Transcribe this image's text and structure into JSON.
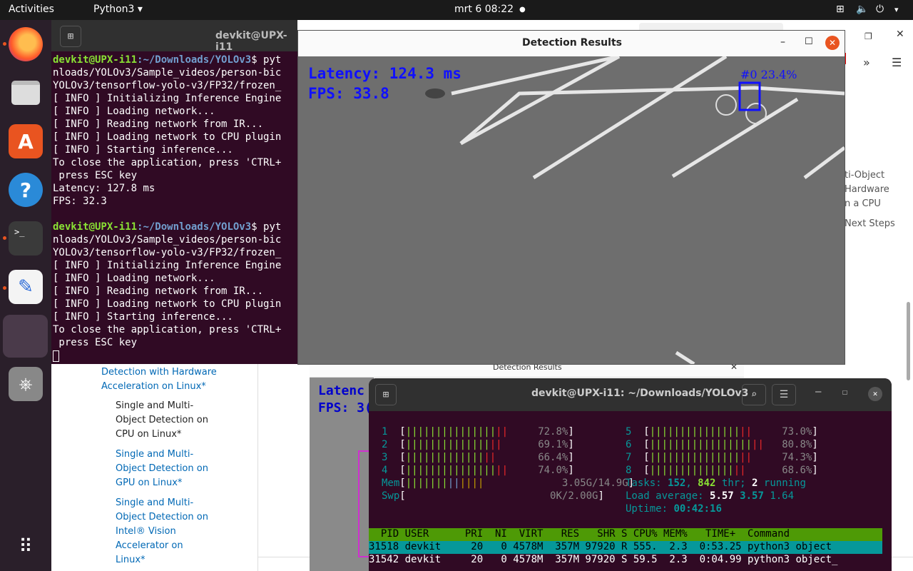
{
  "topbar": {
    "activities": "Activities",
    "app": "Python3",
    "datetime": "mrt 6  08:22"
  },
  "dock": {
    "items": [
      "firefox",
      "files",
      "software",
      "help",
      "terminal",
      "text-editor",
      "active-window",
      "usb"
    ]
  },
  "browser": {
    "toc": [
      "Detection with Hardware",
      "Acceleration on Linux*",
      "Single and Multi-",
      "Object Detection on",
      "CPU on Linux*",
      "Single and Multi-",
      "Object Detection on",
      "GPU on Linux*",
      "Single and Multi-",
      "Object Detection on",
      "Intel® Vision",
      "Accelerator on",
      "Linux*"
    ],
    "right_nav": [
      "ti-Object",
      "Hardware",
      "n a CPU",
      "Next Steps"
    ],
    "second_window_title": "Detection Results",
    "second_latency": "Latenc",
    "second_fps": "FPS: 3("
  },
  "terminal1": {
    "title": "devkit@UPX-i11",
    "lines": [
      {
        "user": "devkit@UPX-i11",
        "path": ":~/Downloads/YOLOv3",
        "rest": "$ pyt"
      },
      {
        "text": "nloads/YOLOv3/Sample_videos/person-bic"
      },
      {
        "text": "YOLOv3/tensorflow-yolo-v3/FP32/frozen_"
      },
      {
        "text": "[ INFO ] Initializing Inference Engine"
      },
      {
        "text": "[ INFO ] Loading network..."
      },
      {
        "text": "[ INFO ] Reading network from IR..."
      },
      {
        "text": "[ INFO ] Loading network to CPU plugin"
      },
      {
        "text": "[ INFO ] Starting inference..."
      },
      {
        "text": "To close the application, press 'CTRL+"
      },
      {
        "text": " press ESC key"
      },
      {
        "text": "Latency: 127.8 ms"
      },
      {
        "text": "FPS: 32.3"
      },
      {
        "text": ""
      },
      {
        "user": "devkit@UPX-i11",
        "path": ":~/Downloads/YOLOv3",
        "rest": "$ pyt"
      },
      {
        "text": "nloads/YOLOv3/Sample_videos/person-bic"
      },
      {
        "text": "YOLOv3/tensorflow-yolo-v3/FP32/frozen_"
      },
      {
        "text": "[ INFO ] Initializing Inference Engine"
      },
      {
        "text": "[ INFO ] Loading network..."
      },
      {
        "text": "[ INFO ] Reading network from IR..."
      },
      {
        "text": "[ INFO ] Loading network to CPU plugin"
      },
      {
        "text": "[ INFO ] Starting inference..."
      },
      {
        "text": "To close the application, press 'CTRL+"
      },
      {
        "text": " press ESC key"
      }
    ]
  },
  "detection": {
    "title": "Detection Results",
    "latency": "Latency: 124.3 ms",
    "fps": "FPS: 33.8",
    "label": "#0 23.4%"
  },
  "htop": {
    "title": "devkit@UPX-i11: ~/Downloads/YOLOv3",
    "cpus": [
      {
        "id": "1",
        "pct": "72.8%",
        "fill": 0.728
      },
      {
        "id": "2",
        "pct": "69.1%",
        "fill": 0.691
      },
      {
        "id": "3",
        "pct": "66.4%",
        "fill": 0.664
      },
      {
        "id": "4",
        "pct": "74.0%",
        "fill": 0.74
      },
      {
        "id": "5",
        "pct": "73.0%",
        "fill": 0.73
      },
      {
        "id": "6",
        "pct": "80.8%",
        "fill": 0.808
      },
      {
        "id": "7",
        "pct": "74.3%",
        "fill": 0.743
      },
      {
        "id": "8",
        "pct": "68.6%",
        "fill": 0.686
      }
    ],
    "mem": "3.05G/14.9G",
    "swp": "0K/2.00G",
    "tasks_label": "Tasks: ",
    "tasks": "152",
    "thr": "842",
    "thr_label": " thr; ",
    "running": "2",
    "running_label": " running",
    "load_label": "Load average: ",
    "load1": "5.57",
    "load5": "3.57",
    "load15": "1.64",
    "uptime_label": "Uptime: ",
    "uptime": "00:42:16",
    "header": "  PID USER      PRI  NI  VIRT   RES   SHR S CPU% MEM%   TIME+  Command",
    "rows": [
      "31518 devkit     20   0 4578M  357M 97920 R 555.  2.3  0:53.25 python3 object",
      "31542 devkit     20   0 4578M  357M 97920 S 59.5  2.3  0:04.99 python3 object_"
    ]
  }
}
